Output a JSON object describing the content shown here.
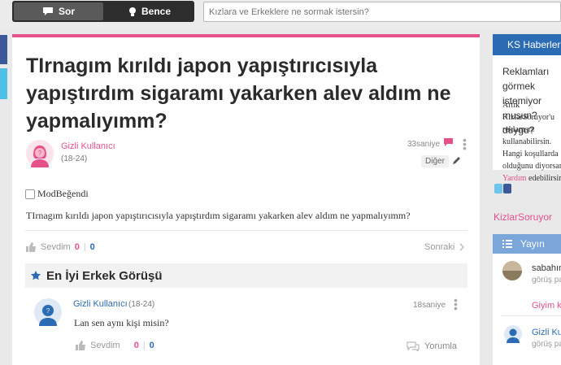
{
  "header": {
    "tab_sor": "Sor",
    "tab_bence": "Bence",
    "search_placeholder": "Kızlara ve Erkeklere ne sormak istersin?"
  },
  "question": {
    "title": "TIrnagım kırıldı japon yapıştırıcısıyla yapıştırdım sigaramı yakarken alev aldım ne yapmalıyımm?",
    "author": "Gizli Kullanıcı",
    "author_age": "(18-24)",
    "time": "33saniye",
    "category": "Diğer",
    "checkbox_label": "ModBeğendi",
    "body": "TIrnagım kırıldı japon yapıştırıcısıyla yapıştırdım sigaramı yakarken alev aldım ne yapmalıyımm?",
    "vote_label": "Sevdim",
    "vote_pos": "0",
    "vote_sep": "|",
    "vote_neg": "0",
    "next_label": "Sonraki"
  },
  "best_answer": {
    "header": "En İyi Erkek Görüşü",
    "author": "Gizli Kullanıcı",
    "author_age": "(18-24)",
    "time": "18saniye",
    "text": "Lan sen aynı kişi misin?",
    "vote_label": "Sevdim",
    "vote_pos": "0",
    "vote_sep": "|",
    "vote_neg": "0",
    "comment_label": "Yorumla"
  },
  "sidebar": {
    "news_title": "KS Haberleri",
    "news_question": "Reklamları görmek istemiyor musun? duygu?",
    "news_text_1": "Artık KizlarSoruyor'u reklamsız kullanabilirsin. Hangi koşullarda olduğunu diyorsan ",
    "news_link": "Yardım",
    "news_text_2": "edebilirsin.",
    "brand_link": "KizlarSoruyor",
    "publish_title": "Yayın",
    "item1_name": "sabahın",
    "item1_sub": "görüş paylaştı",
    "item1_pink": "Giyim ko",
    "item2_name": "Gizli Kullanıcı",
    "item2_sub": "görüş paylaştı"
  },
  "colors": {
    "brand_pink": "#e6518a",
    "brand_blue": "#2b6cb5",
    "dark_bar": "#2d2d2d"
  }
}
